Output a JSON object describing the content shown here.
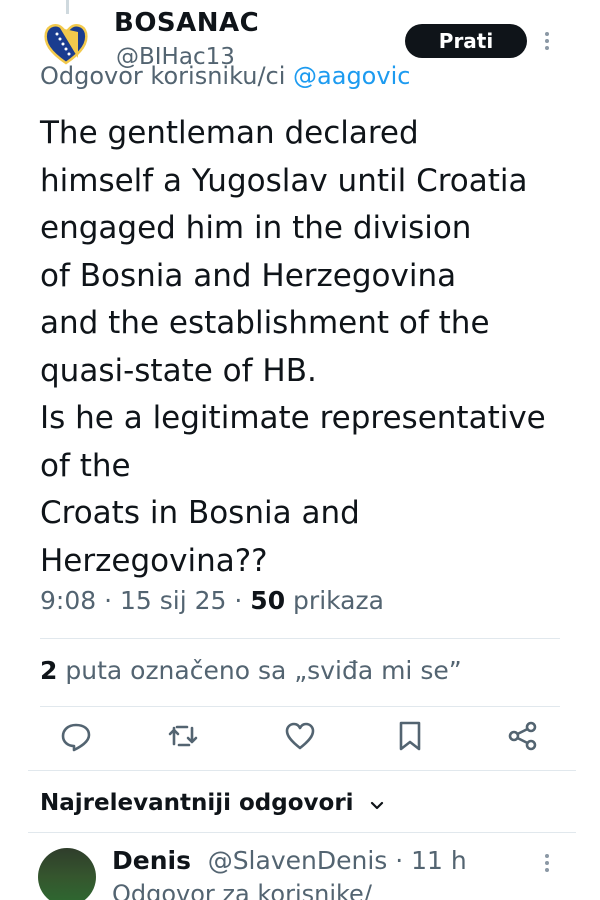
{
  "tweet": {
    "display_name": "BOSANAC",
    "handle": "@BIHac13",
    "reply_prefix": "Odgovor korisniku/ci",
    "reply_mention": "@aagovic",
    "follow_label": "Prati",
    "text_lines": [
      "The gentleman declared",
      "himself a Yugoslav until Croatia",
      "engaged him in the division",
      "of Bosnia and Herzegovina",
      "and the establishment of the",
      "quasi-state of HB.",
      "Is he a legitimate representative",
      "of the",
      "Croats in Bosnia and",
      "Herzegovina??"
    ],
    "time": "9:08",
    "date": "15 sij 25",
    "views_count": "50",
    "views_label": "prikaza",
    "likes_count": "2",
    "likes_label": "puta označeno sa „sviđa mi se”"
  },
  "actions": {
    "icons": [
      "reply-icon",
      "retweet-icon",
      "like-icon",
      "bookmark-icon",
      "share-icon"
    ]
  },
  "replies_section": {
    "sort_label": "Najrelevantniji odgovori"
  },
  "reply": {
    "name": "Denis",
    "handle": "@SlavenDenis",
    "time": "11 h",
    "sub_text": "Odgovor za korisnike/"
  },
  "colors": {
    "text": "#0f1419",
    "secondary": "#536471",
    "link": "#1d9bf0",
    "follow_bg": "#0f1419"
  }
}
